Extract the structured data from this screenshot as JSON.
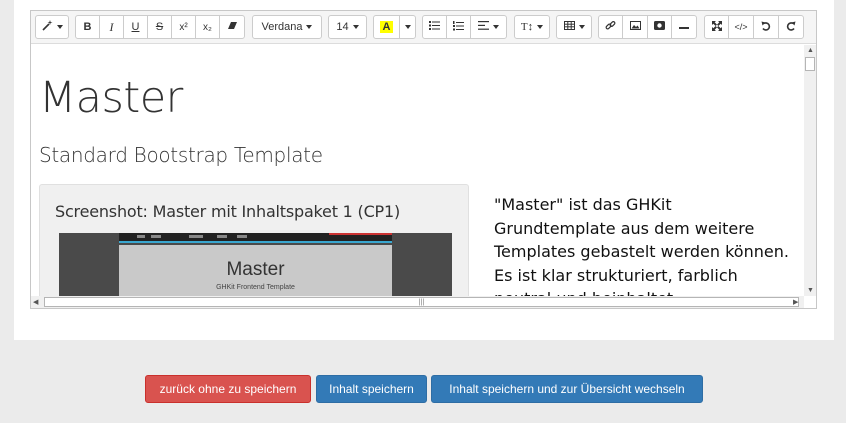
{
  "toolbar": {
    "style_icon": "magic-wand-icon",
    "bold": "B",
    "italic": "I",
    "underline": "U",
    "strikethrough": "S",
    "superscript": "x²",
    "subscript": "x₂",
    "eraser_icon": "eraser-icon",
    "font_name": "Verdana",
    "font_size": "14",
    "color_letter": "A",
    "ul_icon": "unordered-list-icon",
    "ol_icon": "ordered-list-icon",
    "align_icon": "align-icon",
    "line_height_label": "T↕",
    "table_icon": "table-icon",
    "link_icon": "link-icon",
    "picture_icon": "picture-icon",
    "video_icon": "video-icon",
    "hr_icon": "horizontal-rule-icon",
    "fullscreen_icon": "fullscreen-icon",
    "codeview_icon": "code-view-icon",
    "undo_icon": "undo-icon",
    "redo_icon": "redo-icon",
    "highlight_color": "#ffff00"
  },
  "content": {
    "heading": "Master",
    "subheading": "Standard Bootstrap Template",
    "well_title": "Screenshot: Master mit Inhaltspaket 1 (CP1)",
    "screenshot": {
      "title": "Master",
      "subtitle": "GHKit Frontend Template"
    },
    "paragraph": "\"Master\" ist das GHKit Grundtemplate aus dem weitere Templates gebastelt werden können. Es ist klar strukturiert, farblich neutral und beinhaltet"
  },
  "actions": {
    "back_label": "zurück ohne zu speichern",
    "save_label": "Inhalt speichern",
    "save_overview_label": "Inhalt speichern und zur Übersicht wechseln"
  },
  "colors": {
    "danger": "#d9534f",
    "primary": "#337ab7"
  }
}
